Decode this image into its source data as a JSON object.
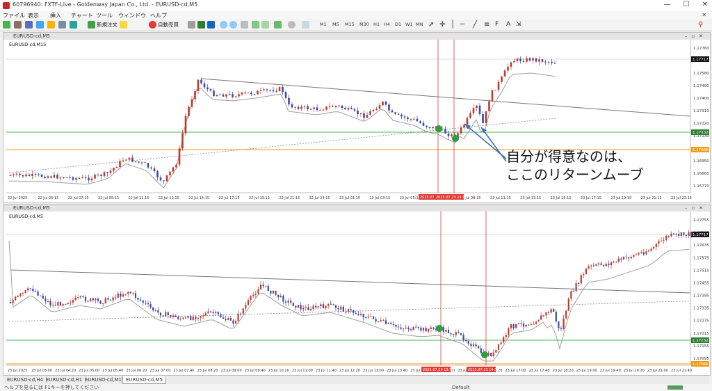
{
  "window": {
    "title": "60796940: FXTF-Live - Goldenway Japan Co., Ltd. - EURUSD-cd,M5"
  },
  "menu": [
    "ファイル",
    "表示",
    "挿入",
    "チャート",
    "ツール",
    "ウィンドウ",
    "ヘルプ"
  ],
  "toolbar": {
    "new_order": "新規注文",
    "auto_trade": "自動売買",
    "timeframes": [
      "M1",
      "M5",
      "M15",
      "M30",
      "H1",
      "H4",
      "D1",
      "W1",
      "MN"
    ]
  },
  "charts": [
    {
      "title": "EURUSD-cd,M5",
      "label": "EURUSD-cd,M15",
      "price_axis": [
        "1.17760",
        "1.17670",
        "1.17580",
        "1.17490",
        "1.17400",
        "1.17310",
        "1.17220",
        "1.17130",
        "1.17040",
        "1.16950",
        "1.16860",
        "1.16770"
      ],
      "price_badges": {
        "current": "1.17717",
        "green": "1.17232",
        "orange": "1.17066"
      },
      "time_axis": [
        "22 Jul 2025",
        "22 Jul 05:15",
        "22 Jul 07:15",
        "22 Jul 09:15",
        "22 Jul 11:15",
        "22 Jul 13:15",
        "22 Jul 15:15",
        "22 Jul 17:15",
        "22 Jul 19:15",
        "22 Jul 21:15",
        "22 Jul 23:15",
        "23 Jul 01:15",
        "23 Jul 03:15",
        "23 Jul 05:15",
        "23 Jul 07:15",
        "23 Jul 09:15",
        "23 Jul 11:15",
        "23 Jul 13:15",
        "23 Jul 15:15",
        "23 Jul 17:15",
        "23 Jul 19:15",
        "23 Jul 21:15",
        "23 Jul 23:15"
      ],
      "vline_labels": [
        "2025.07.23 13:15",
        "2025.07.23 14:15"
      ]
    },
    {
      "title": "EURUSD-cd,M5",
      "label": "EURUSD-cd,M5",
      "price_axis": [
        "1.17755",
        "1.17695",
        "1.17635",
        "1.17575",
        "1.17515",
        "1.17455",
        "1.17395",
        "1.17335",
        "1.17275",
        "1.17215",
        "1.17155",
        "1.17095"
      ],
      "price_badges": {
        "current": "1.17717",
        "green": "1.17232",
        "orange": "1.17066"
      },
      "time_axis": [
        "23 Jul 2025",
        "23 Jul 03:00",
        "23 Jul 04:20",
        "23 Jul 05:00",
        "23 Jul 05:40",
        "23 Jul 06:20",
        "23 Jul 07:00",
        "23 Jul 07:40",
        "23 Jul 08:20",
        "23 Jul 09:00",
        "23 Jul 09:40",
        "23 Jul 10:20",
        "23 Jul 11:00",
        "23 Jul 11:40",
        "23 Jul 12:20",
        "23 Jul 13:00",
        "23 Jul 13:40",
        "23 Jul 14:20",
        "23 Jul 15:00",
        "23 Jul 15:40",
        "23 Jul 16:20",
        "23 Jul 17:00",
        "23 Jul 17:40",
        "23 Jul 18:20",
        "23 Jul 19:00",
        "23 Jul 19:40",
        "23 Jul 20:20",
        "23 Jul 21:00",
        "23 Jul 21:40"
      ],
      "vline_labels": [
        "2025.07.23 13:15",
        "2025.07.23 14:30"
      ]
    }
  ],
  "annotation": {
    "line1": "自分が得意なのは、",
    "line2": "ここのリターンムーブ"
  },
  "tabs": [
    "EURUSD-cd,H4",
    "EURUSD-cd,H1",
    "EURUSD-cd,M15",
    "EURUSD-cd,M5"
  ],
  "status": {
    "help": "ヘルプを見るには F1キーを押してください",
    "profile": "Default"
  },
  "colors": {
    "bull": "#1a1a1a",
    "bear": "#c0392b",
    "up_candle": "#c0392b",
    "down_candle": "#3949ab",
    "green_line": "#4caf50",
    "orange_line": "#ff9800",
    "red_vline": "#e53935",
    "ma": "#9e9e9e",
    "marker": "#2e9e3e"
  }
}
